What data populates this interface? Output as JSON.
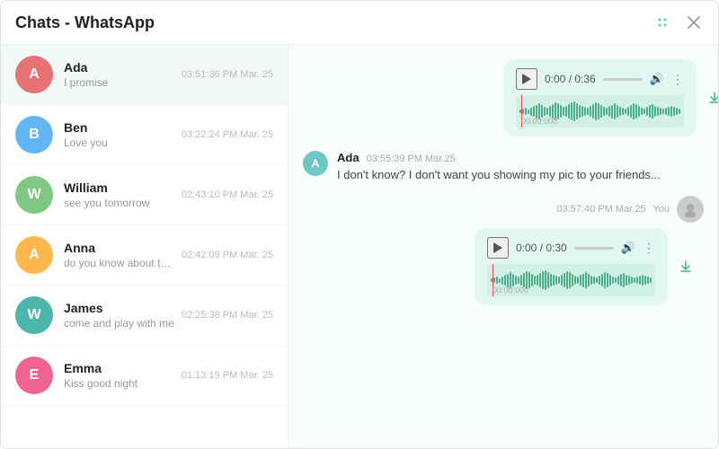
{
  "titleBar": {
    "title": "Chats - WhatsApp",
    "gridIcon": "⠿",
    "closeIcon": "✕"
  },
  "chatList": [
    {
      "id": "ada",
      "name": "Ada",
      "preview": "I promise",
      "time": "03:51:36 PM Mar. 25",
      "avatarColor": "#e57373",
      "initial": "A",
      "active": true
    },
    {
      "id": "ben",
      "name": "Ben",
      "preview": "Love you",
      "time": "03:22:24 PM Mar. 25",
      "avatarColor": "#64b5f6",
      "initial": "B",
      "active": false
    },
    {
      "id": "william",
      "name": "William",
      "preview": "see you tomorrow",
      "time": "02:43:10 PM Mar. 25",
      "avatarColor": "#81c784",
      "initial": "W",
      "active": false
    },
    {
      "id": "anna",
      "name": "Anna",
      "preview": "do you know about that",
      "time": "02:42:09 PM Mar. 25",
      "avatarColor": "#ffb74d",
      "initial": "A",
      "active": false
    },
    {
      "id": "james",
      "name": "James",
      "preview": "come and play with me",
      "time": "02:25:38 PM Mar. 25",
      "avatarColor": "#4db6ac",
      "initial": "W",
      "active": false
    },
    {
      "id": "emma",
      "name": "Emma",
      "preview": "Kiss good night",
      "time": "01:13:19 PM Mar. 25",
      "avatarColor": "#f06292",
      "initial": "E",
      "active": false
    }
  ],
  "chatArea": {
    "incomingAudio1": {
      "timeDisplay": "0:00 / 0:36",
      "waveformTimestamp": "00:00:000",
      "barCount": 60
    },
    "incomingMessage": {
      "senderInitial": "A",
      "senderName": "Ada",
      "timestamp": "03:55:39 PM Mar.25",
      "text": "I don't know? I don't want you showing my pic to your friends..."
    },
    "outgoingSection": {
      "timestamp": "03:57:40 PM Mar.25",
      "you": "You",
      "audio": {
        "timeDisplay": "0:00 / 0:30",
        "waveformTimestamp": "00:00:000",
        "barCount": 60
      }
    }
  }
}
